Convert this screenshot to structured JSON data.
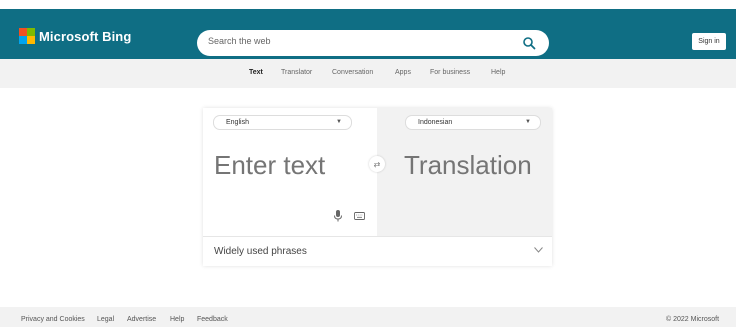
{
  "header": {
    "logo_text": "Microsoft Bing",
    "logo_colors": [
      "#f25022",
      "#7fba00",
      "#00a4ef",
      "#ffb900"
    ],
    "search_placeholder": "Search the web",
    "search_icon": "search-icon",
    "signin_label": "Sign in",
    "bar_color": "#0f6e84"
  },
  "subnav": {
    "items": [
      {
        "label": "Text",
        "active": true
      },
      {
        "label": "Translator",
        "active": false
      },
      {
        "label": "Conversation",
        "active": false
      },
      {
        "label": "Apps",
        "active": false
      },
      {
        "label": "For business",
        "active": false
      },
      {
        "label": "Help",
        "active": false
      }
    ]
  },
  "translator": {
    "source_language": "English",
    "target_language": "Indonesian",
    "source_placeholder": "Enter text",
    "target_placeholder": "Translation",
    "swap_icon": "swap-icon",
    "mic_icon": "microphone-icon",
    "keyboard_icon": "keyboard-icon",
    "phrases_label": "Widely used phrases"
  },
  "footer": {
    "links": [
      "Privacy and Cookies",
      "Legal",
      "Advertise",
      "Help",
      "Feedback"
    ],
    "copyright": "© 2022 Microsoft"
  }
}
